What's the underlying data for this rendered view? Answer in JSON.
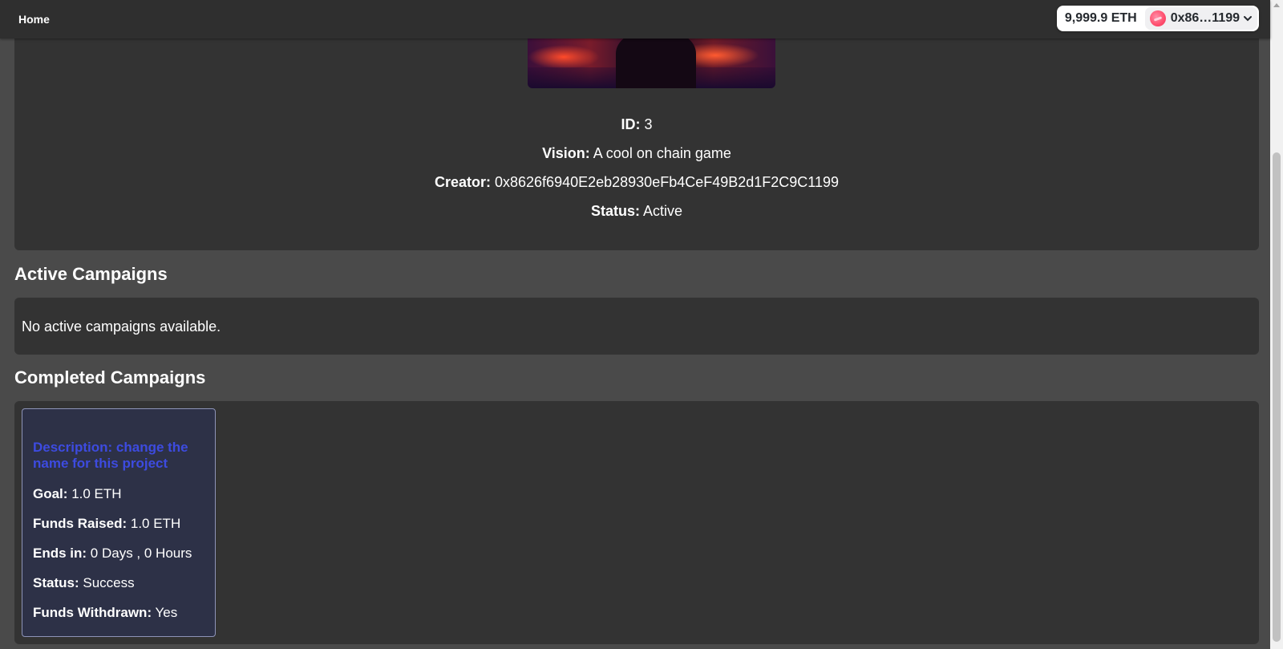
{
  "nav": {
    "home_label": "Home"
  },
  "wallet": {
    "balance": "9,999.9 ETH",
    "address": "0x86…1199",
    "avatar_color": "#ff4d6d"
  },
  "project": {
    "id_label": "ID:",
    "id": "3",
    "vision_label": "Vision:",
    "vision": "A cool on chain game",
    "creator_label": "Creator:",
    "creator": "0x8626f6940E2eb28930eFb4CeF49B2d1F2C9C1199",
    "status_label": "Status:",
    "status": "Active"
  },
  "active_campaigns": {
    "title": "Active Campaigns",
    "empty_text": "No active campaigns available."
  },
  "completed_campaigns": {
    "title": "Completed Campaigns",
    "items": [
      {
        "description": "Description: change the name for this project",
        "goal_label": "Goal:",
        "goal": "1.0 ETH",
        "raised_label": "Funds Raised:",
        "raised": "1.0 ETH",
        "ends_label": "Ends in:",
        "ends": "0 Days , 0 Hours",
        "status_label": "Status:",
        "status": "Success",
        "withdrawn_label": "Funds Withdrawn:",
        "withdrawn": "Yes"
      }
    ]
  },
  "colors": {
    "page_bg": "#4a4a4a",
    "panel_bg": "#333333",
    "card_bg": "#2d3147",
    "description_color": "#3d4be0"
  }
}
